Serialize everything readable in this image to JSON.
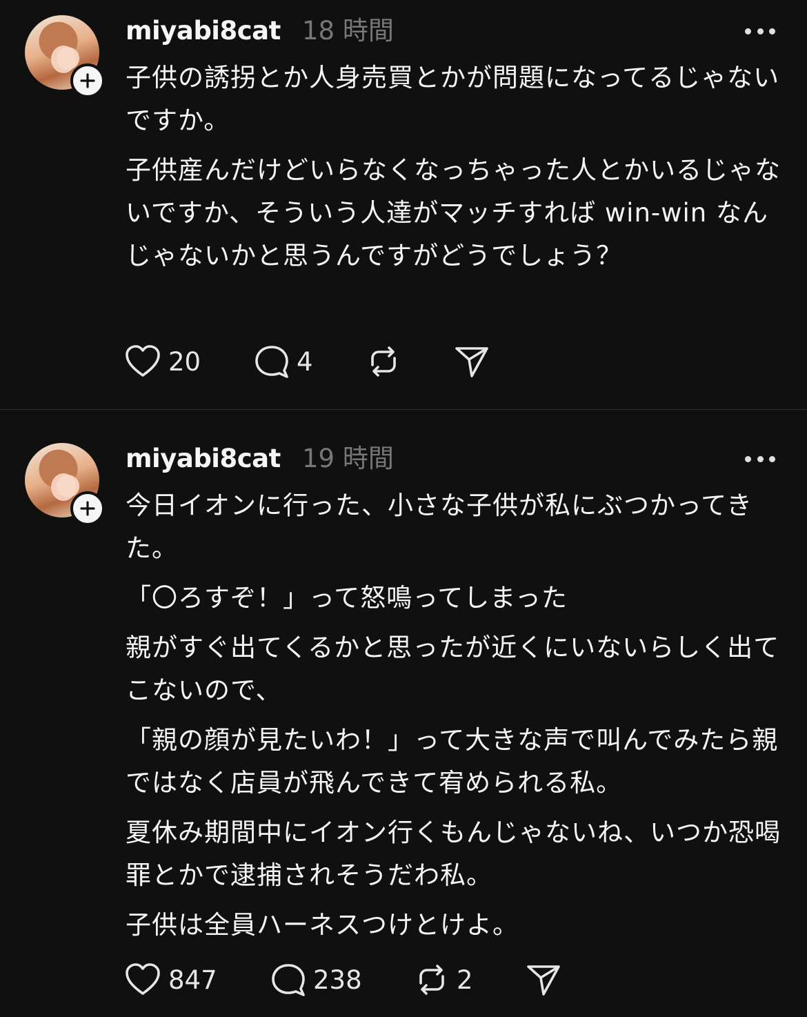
{
  "posts": [
    {
      "username": "miyabi8cat",
      "time": "18 時間",
      "paragraphs": [
        "子供の誘拐とか人身売買とかが問題になってるじゃないですか。",
        "子供産んだけどいらなくなっちゃった人とかいるじゃないですか、そういう人達がマッチすれば win-win なんじゃないかと思うんですがどうでしょう？"
      ],
      "likes": "20",
      "replies": "4",
      "reposts": ""
    },
    {
      "username": "miyabi8cat",
      "time": "19 時間",
      "paragraphs": [
        "今日イオンに行った、小さな子供が私にぶつかってきた。",
        "「〇ろすぞ！」って怒鳴ってしまった",
        "親がすぐ出てくるかと思ったが近くにいないらしく出てこないので、",
        "「親の顔が見たいわ！」って大きな声で叫んでみたら親ではなく店員が飛んできて宥められる私。",
        "夏休み期間中にイオン行くもんじゃないね、いつか恐喝罪とかで逮捕されそうだわ私。",
        "子供は全員ハーネスつけとけよ。"
      ],
      "likes": "847",
      "replies": "238",
      "reposts": "2"
    }
  ],
  "icons": {
    "like": "heart-icon",
    "reply": "comment-icon",
    "repost": "repost-icon",
    "share": "send-icon",
    "more": "more-icon",
    "follow": "plus-icon"
  },
  "colors": {
    "background": "#101010",
    "text": "#f3f5f7",
    "muted": "#777777"
  }
}
